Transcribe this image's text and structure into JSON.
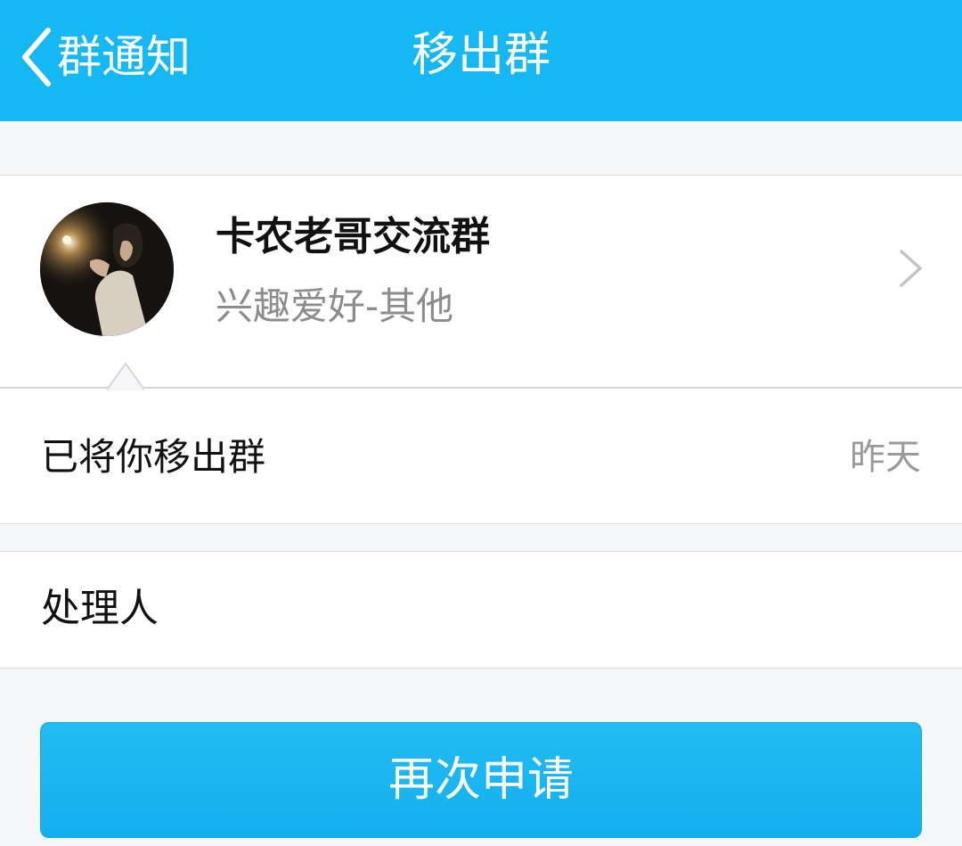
{
  "header": {
    "back_label": "群通知",
    "title": "移出群"
  },
  "group": {
    "name": "卡农老哥交流群",
    "category": "兴趣爱好-其他"
  },
  "notice": {
    "message": "已将你移出群",
    "time": "昨天"
  },
  "handler": {
    "label": "处理人"
  },
  "actions": {
    "reapply_label": "再次申请"
  },
  "colors": {
    "accent": "#15b8f3",
    "background": "#f5f6f8"
  },
  "icons": {
    "back": "chevron-left-icon",
    "forward": "chevron-right-icon"
  }
}
